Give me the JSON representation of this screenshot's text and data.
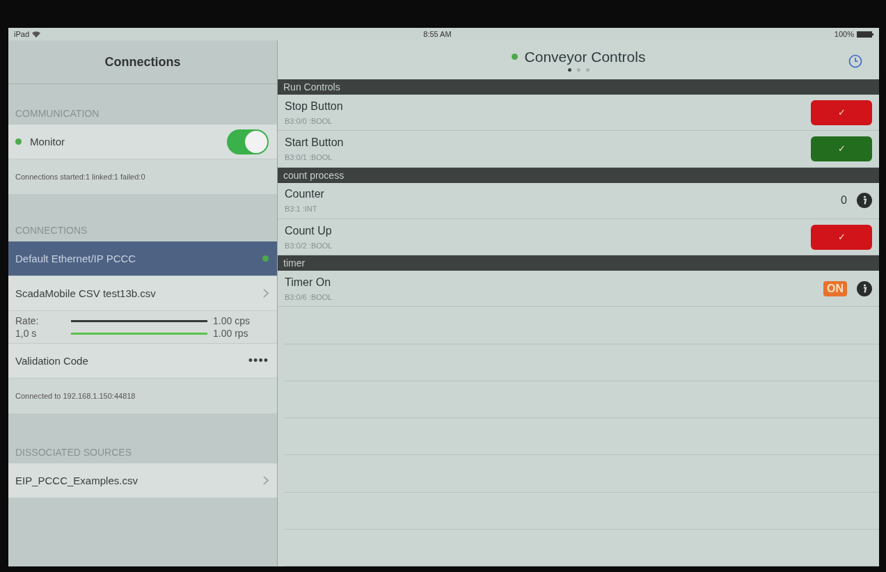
{
  "status_bar": {
    "device": "iPad",
    "time": "8:55 AM",
    "battery": "100%"
  },
  "sidebar": {
    "title": "Connections",
    "communication": {
      "header": "COMMUNICATION",
      "monitor": {
        "label": "Monitor",
        "on": true
      },
      "stats": "Connections started:1 linked:1 failed:0"
    },
    "connections": {
      "header": "CONNECTIONS",
      "items": [
        {
          "kind": "connection",
          "label": "Default Ethernet/IP PCCC",
          "selected": true
        },
        {
          "kind": "file",
          "label": "ScadaMobile CSV test13b.csv"
        }
      ],
      "rate": {
        "label": "Rate:",
        "period": "1,0 s",
        "lines": [
          {
            "reading": "1.00 cps",
            "color": "#333a3a"
          },
          {
            "reading": "1.00 rps",
            "color": "#5cc24a"
          }
        ]
      },
      "validation": {
        "label": "Validation Code",
        "value": "••••"
      },
      "status": "Connected to 192.168.1.150:44818"
    },
    "dissociated": {
      "header": "DISSOCIATED SOURCES",
      "items": [
        {
          "label": "EIP_PCCC_Examples.csv"
        }
      ]
    }
  },
  "main": {
    "title": "Conveyor Controls",
    "pages": [
      {
        "selected": true
      },
      {
        "selected": false
      },
      {
        "selected": false
      }
    ],
    "sections": [
      {
        "title": "Run Controls",
        "rows": [
          {
            "kind": "button",
            "label": "Stop Button",
            "address": "B3:0/0 :BOOL",
            "mark": "✓",
            "color": "#d0141a"
          },
          {
            "kind": "button",
            "label": "Start Button",
            "address": "B3:0/1 :BOOL",
            "mark": "✓",
            "color": "#236e1e"
          }
        ]
      },
      {
        "title": "count process",
        "rows": [
          {
            "kind": "value",
            "label": "Counter",
            "address": "B3:1 :INT",
            "value": "0"
          },
          {
            "kind": "button",
            "label": "Count Up",
            "address": "B3:0/2 :BOOL",
            "mark": "✓",
            "color": "#d0141a"
          }
        ]
      },
      {
        "title": "timer",
        "rows": [
          {
            "kind": "indicator",
            "label": "Timer On",
            "address": "B3:0/6 :BOOL",
            "value": "ON"
          }
        ]
      }
    ]
  }
}
